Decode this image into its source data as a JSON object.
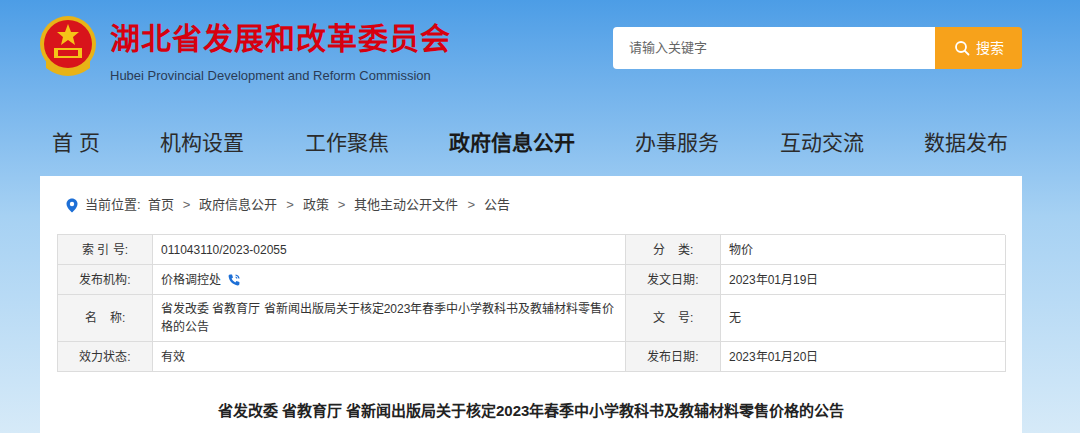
{
  "header": {
    "title": "湖北省发展和改革委员会",
    "subtitle": "Hubei Provincial Development and Reform Commission"
  },
  "search": {
    "placeholder": "请输入关键字",
    "button": "搜索"
  },
  "nav": [
    {
      "label": "首 页",
      "selected": false
    },
    {
      "label": "机构设置",
      "selected": false
    },
    {
      "label": "工作聚焦",
      "selected": false
    },
    {
      "label": "政府信息公开",
      "selected": true
    },
    {
      "label": "办事服务",
      "selected": false
    },
    {
      "label": "互动交流",
      "selected": false
    },
    {
      "label": "数据发布",
      "selected": false
    }
  ],
  "breadcrumb": {
    "prefix": "当前位置:",
    "separator": ">",
    "items": [
      "首页",
      "政府信息公开",
      "政策",
      "其他主动公开文件",
      "公告"
    ]
  },
  "info_table": {
    "rows": [
      [
        {
          "label": "索 引 号:",
          "value": "011043110/2023-02055",
          "contact_icon": false
        },
        {
          "label": "分    类:",
          "value": "物价",
          "contact_icon": false
        }
      ],
      [
        {
          "label": "发布机构:",
          "value": "价格调控处",
          "contact_icon": true
        },
        {
          "label": "发文日期:",
          "value": "2023年01月19日",
          "contact_icon": false
        }
      ],
      [
        {
          "label": "名    称:",
          "value": "省发改委 省教育厅 省新闻出版局关于核定2023年春季中小学教科书及教辅材料零售价格的公告",
          "contact_icon": false
        },
        {
          "label": "文    号:",
          "value": "无",
          "contact_icon": false
        }
      ],
      [
        {
          "label": "效力状态:",
          "value": "有效",
          "contact_icon": false
        },
        {
          "label": "发布日期:",
          "value": "2023年01月20日",
          "contact_icon": false
        }
      ]
    ]
  },
  "article": {
    "title": "省发改委 省教育厅 省新闻出版局关于核定2023年春季中小学教科书及教辅材料零售价格的公告"
  }
}
